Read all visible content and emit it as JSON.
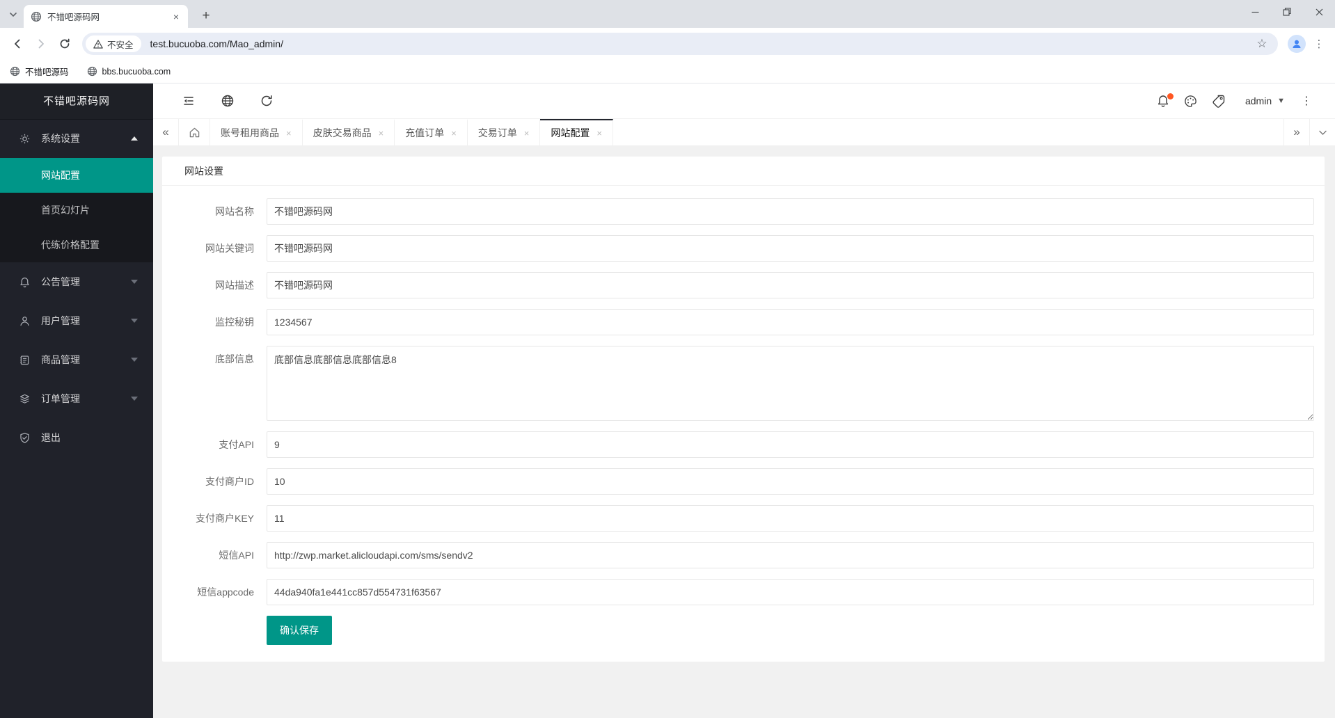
{
  "browser": {
    "tab_title": "不错吧源码网",
    "security_label": "不安全",
    "url": "test.bucuoba.com/Mao_admin/",
    "bookmarks": [
      {
        "label": "不错吧源码"
      },
      {
        "label": "bbs.bucuoba.com"
      }
    ]
  },
  "icons": {
    "close": "×",
    "new_tab": "+",
    "kebab": "⋮",
    "star": "☆",
    "caret_down": "▼",
    "chevrons_left": "«",
    "chevrons_right": "»"
  },
  "admin": {
    "logo": "不错吧源码网",
    "user": "admin",
    "sidebar": {
      "items": [
        {
          "label": "系统设置",
          "icon": "gear-icon",
          "expanded": true
        },
        {
          "label": "公告管理",
          "icon": "bell-icon"
        },
        {
          "label": "用户管理",
          "icon": "user-icon"
        },
        {
          "label": "商品管理",
          "icon": "goods-icon"
        },
        {
          "label": "订单管理",
          "icon": "orders-icon"
        },
        {
          "label": "退出",
          "icon": "logout-icon"
        }
      ],
      "system_children": [
        {
          "label": "网站配置",
          "active": true
        },
        {
          "label": "首页幻灯片"
        },
        {
          "label": "代练价格配置"
        }
      ]
    },
    "tabs": [
      {
        "label": "账号租用商品"
      },
      {
        "label": "皮肤交易商品"
      },
      {
        "label": "充值订单"
      },
      {
        "label": "交易订单"
      },
      {
        "label": "网站配置",
        "active": true
      }
    ],
    "form": {
      "title": "网站设置",
      "fields": [
        {
          "label": "网站名称",
          "value": "不错吧源码网"
        },
        {
          "label": "网站关键词",
          "value": "不错吧源码网"
        },
        {
          "label": "网站描述",
          "value": "不错吧源码网"
        },
        {
          "label": "监控秘钥",
          "value": "1234567"
        },
        {
          "label": "底部信息",
          "value": "底部信息底部信息底部信息8"
        },
        {
          "label": "支付API",
          "value": "9"
        },
        {
          "label": "支付商户ID",
          "value": "10"
        },
        {
          "label": "支付商户KEY",
          "value": "11"
        },
        {
          "label": "短信API",
          "value": "http://zwp.market.alicloudapi.com/sms/sendv2"
        },
        {
          "label": "短信appcode",
          "value": "44da940fa1e441cc857d554731f63567"
        }
      ],
      "submit_label": "确认保存"
    },
    "colors": {
      "accent": "#009688",
      "notification_badge": "#ff5722",
      "sidebar_bg": "#20222A"
    }
  }
}
